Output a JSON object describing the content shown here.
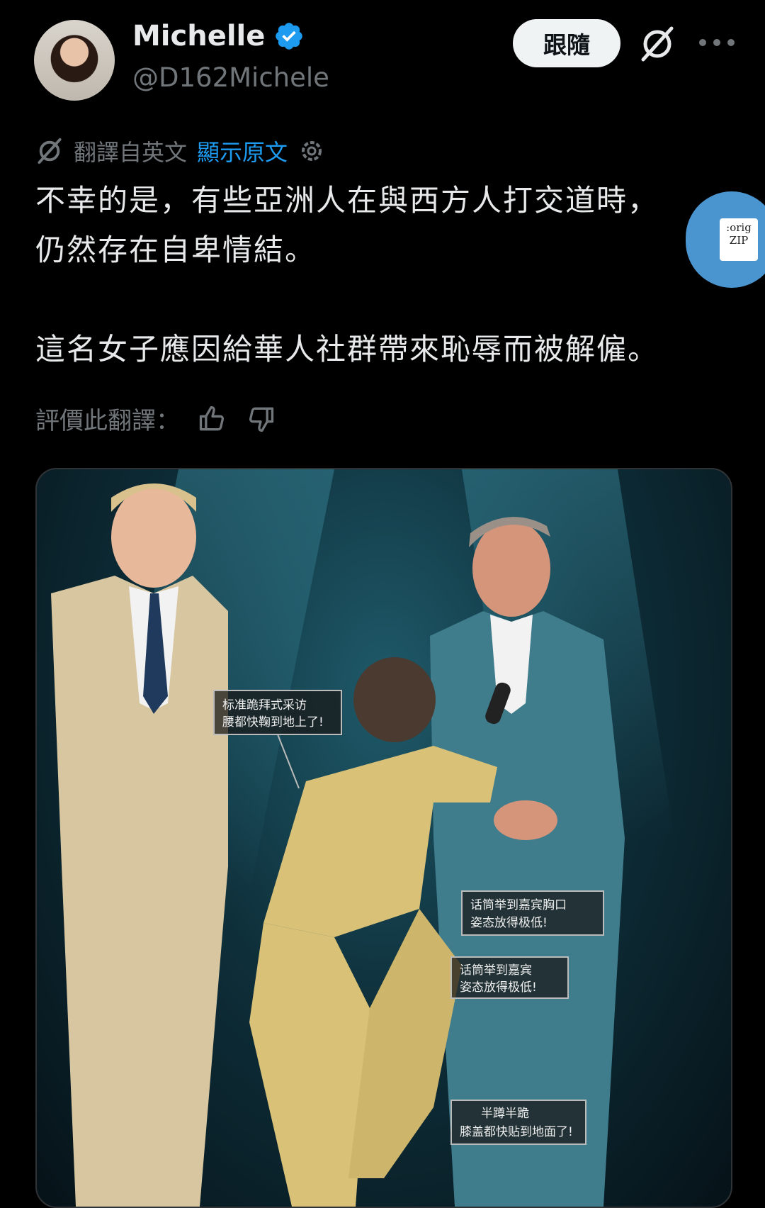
{
  "header": {
    "name": "Michelle",
    "handle": "@D162Michele",
    "follow_label": "跟隨"
  },
  "translation": {
    "label": "翻譯自英文",
    "show_original": "顯示原文"
  },
  "tweet": {
    "text": "不幸的是，有些亞洲人在與西方人打交道時，\n仍然存在自卑情結。\n\n這名女子應因給華人社群帶來恥辱而被解僱。"
  },
  "rating": {
    "label": "評價此翻譯："
  },
  "zip_badge": {
    "line1": ":orig",
    "line2": "ZIP"
  },
  "media": {
    "callouts": [
      {
        "line1": "标准跪拜式采访",
        "line2": "腰都快鞠到地上了!"
      },
      {
        "line1": "话筒举到嘉宾胸口",
        "line2": "姿态放得极低!"
      },
      {
        "line1": "话筒举到嘉宾",
        "line2": "姿态放得极低!"
      },
      {
        "line1": "半蹲半跪",
        "line2": "膝盖都快贴到地面了!"
      }
    ]
  },
  "colors": {
    "background": "#000000",
    "text": "#e7e9ea",
    "muted": "#71767b",
    "link": "#1d9bf0",
    "verified": "#1d9bf0"
  }
}
